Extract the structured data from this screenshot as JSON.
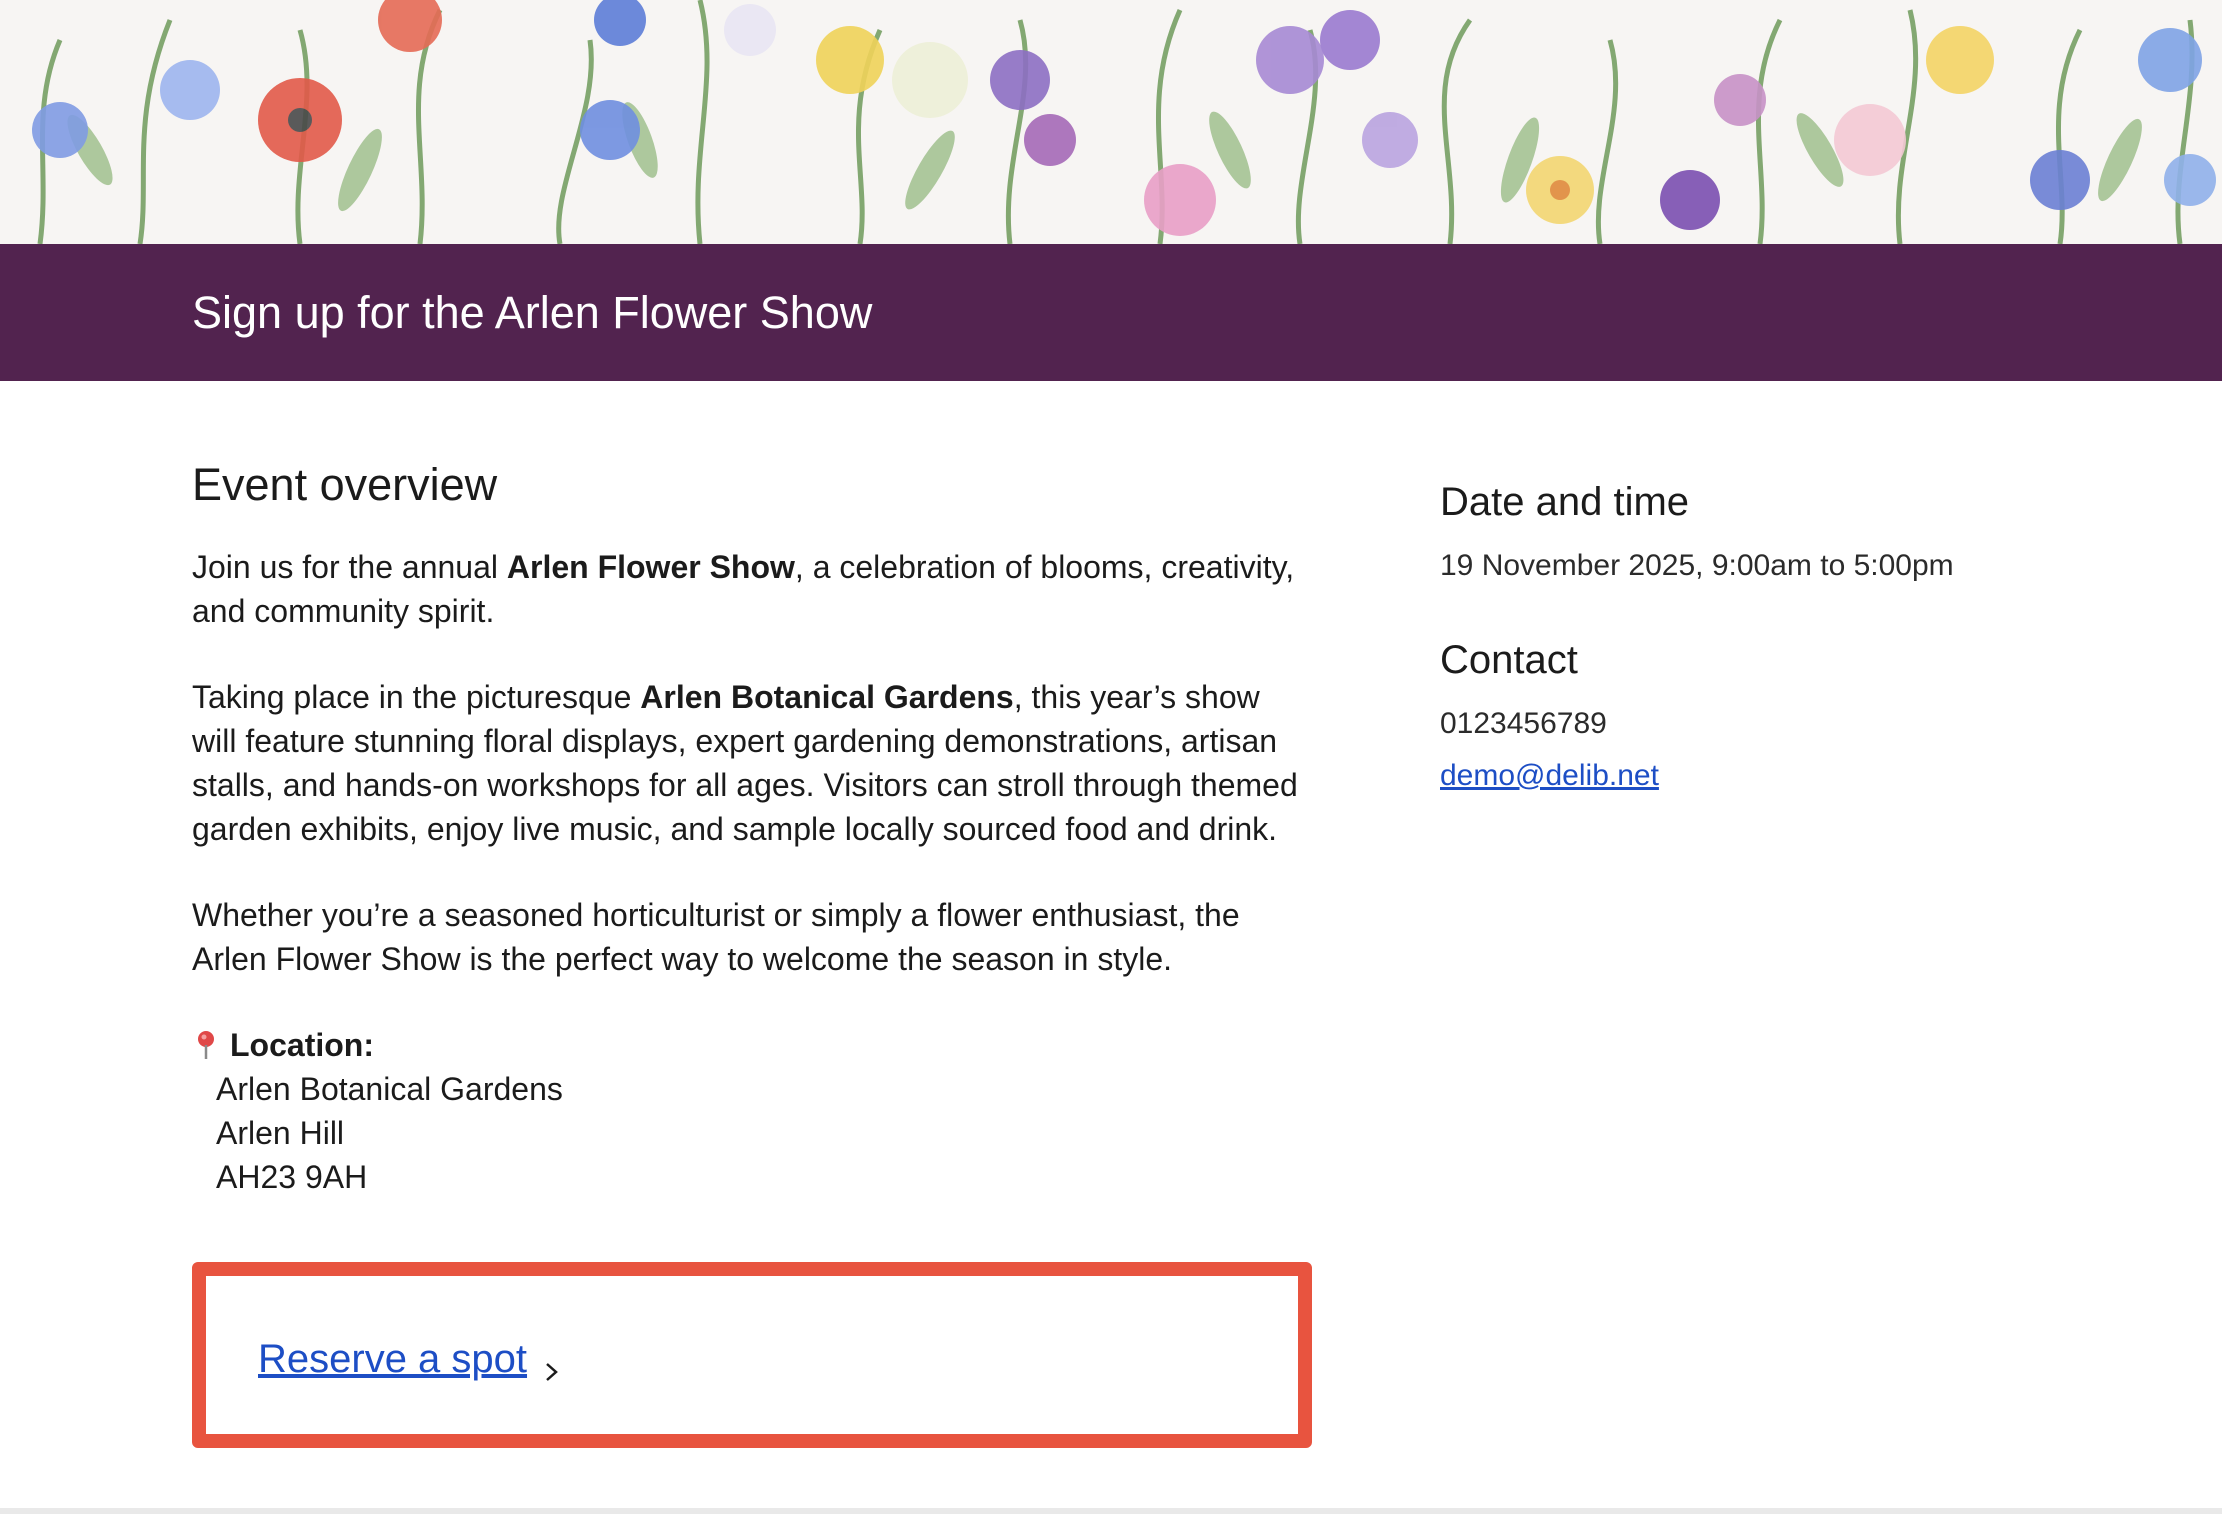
{
  "header": {
    "title": "Sign up for the Arlen Flower Show",
    "banner_icon": "watercolor-wildflower-banner"
  },
  "overview": {
    "heading": "Event overview",
    "p1_before": "Join us for the annual ",
    "p1_bold": "Arlen Flower Show",
    "p1_after": ", a celebration of blooms, creativity, and community spirit.",
    "p2_before": "Taking place in the picturesque ",
    "p2_bold": "Arlen Botanical Gardens",
    "p2_after": ", this year’s show will feature stunning floral displays, expert gardening demonstrations, artisan stalls, and hands-on workshops for all ages. Visitors can stroll through themed garden exhibits, enjoy live music, and sample locally sourced food and drink.",
    "p3": "Whether you’re a seasoned horticulturist or simply a flower enthusiast, the Arlen Flower Show is the perfect way to welcome the season in style.",
    "location_label": "Location:",
    "location_icon": "pin-icon",
    "address": [
      "Arlen Botanical Gardens",
      "Arlen Hill",
      "AH23 9AH"
    ]
  },
  "reserve": {
    "label": "Reserve a spot",
    "icon": "chevron-right-icon",
    "highlight_color": "#e8543f"
  },
  "sidebar": {
    "date_heading": "Date and time",
    "date_value": "19 November 2025, 9:00am to 5:00pm",
    "contact_heading": "Contact",
    "phone": "0123456789",
    "email": "demo@delib.net"
  },
  "colors": {
    "brand_purple": "#52234f",
    "link_blue": "#1d4ec5"
  }
}
